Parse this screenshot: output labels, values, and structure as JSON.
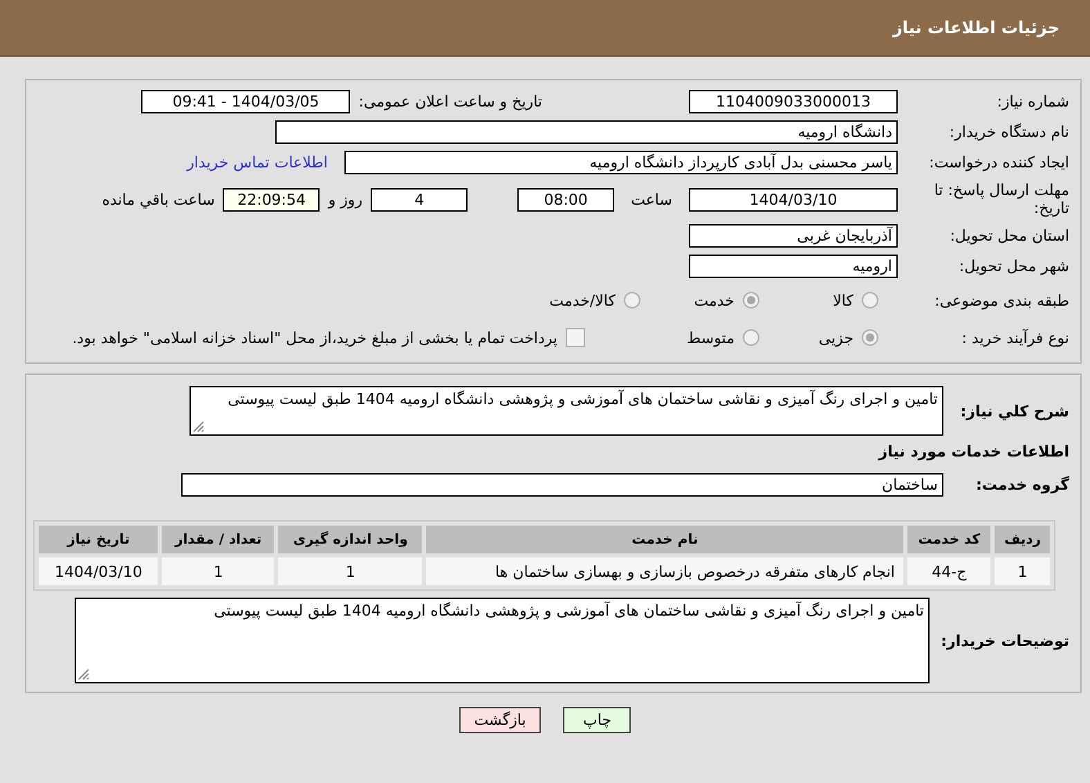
{
  "header": {
    "title": "جزئیات اطلاعات نیاز"
  },
  "need_number": {
    "label": "شماره نیاز:",
    "value": "1104009033000013"
  },
  "announce": {
    "label": "تاریخ و ساعت اعلان عمومی:",
    "value": "1404/03/05 - 09:41"
  },
  "buyer": {
    "label": "نام دستگاه خریدار:",
    "value": "دانشگاه ارومیه"
  },
  "creator": {
    "label": "ایجاد کننده درخواست:",
    "value": "یاسر محسنی بدل آبادی کارپرداز دانشگاه ارومیه",
    "link": "اطلاعات تماس خریدار"
  },
  "deadline": {
    "label": "مهلت ارسال پاسخ: تا تاریخ:",
    "date": "1404/03/10",
    "time_label": "ساعت",
    "time": "08:00",
    "days": "4",
    "days_label": "روز و",
    "remaining": "22:09:54",
    "remaining_label": "ساعت باقي مانده"
  },
  "province": {
    "label": "استان محل تحویل:",
    "value": "آذربایجان غربی"
  },
  "city": {
    "label": "شهر محل تحویل:",
    "value": "ارومیه"
  },
  "category": {
    "label": "طبقه بندی موضوعی:",
    "options": [
      {
        "label": "کالا",
        "selected": false
      },
      {
        "label": "خدمت",
        "selected": true
      },
      {
        "label": "کالا/خدمت",
        "selected": false
      }
    ]
  },
  "process": {
    "label": "نوع فرآیند خرید :",
    "options": [
      {
        "label": "جزیی",
        "selected": true
      },
      {
        "label": "متوسط",
        "selected": false
      }
    ],
    "treasury": {
      "checked": false,
      "label": "پرداخت تمام یا بخشی از مبلغ خرید،از محل \"اسناد خزانه اسلامی\" خواهد بود."
    }
  },
  "summary": {
    "label": "شرح کلي نياز:",
    "value": "تامین و اجرای رنگ آمیزی و نقاشی ساختمان های آموزشی و پژوهشی دانشگاه ارومیه 1404 طبق لیست پیوستی"
  },
  "services_title": "اطلاعات خدمات مورد نیاز",
  "service_group": {
    "label": "گروه خدمت:",
    "value": "ساختمان"
  },
  "table": {
    "columns": [
      "ردیف",
      "کد خدمت",
      "نام خدمت",
      "واحد اندازه گیری",
      "تعداد / مقدار",
      "تاریخ نیاز"
    ],
    "rows": [
      [
        "1",
        "ج-44",
        "انجام کارهای متفرقه درخصوص بازسازی و بهسازی ساختمان ها",
        "1",
        "1",
        "1404/03/10"
      ]
    ]
  },
  "buyer_notes": {
    "label": "توضیحات خریدار:",
    "value": "تامین و اجرای رنگ آمیزی و نقاشی ساختمان های آموزشی و پژوهشی دانشگاه ارومیه 1404 طبق لیست پیوستی"
  },
  "buttons": [
    {
      "label": "چاپ",
      "kind": "print"
    },
    {
      "label": "بازگشت",
      "kind": "back"
    }
  ]
}
